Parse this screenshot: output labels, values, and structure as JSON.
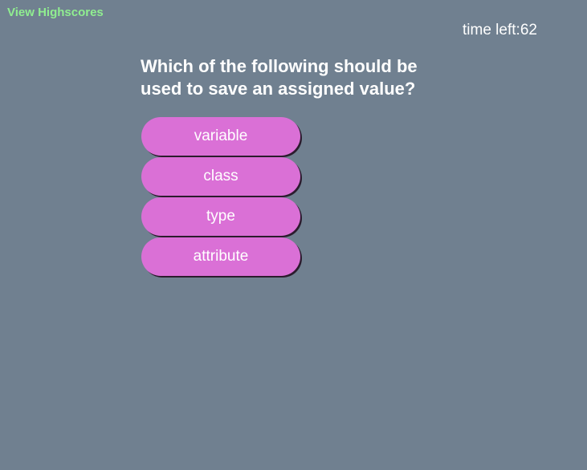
{
  "header": {
    "highscores_link": "View Highscores",
    "timer_label": "time left:",
    "timer_value": "62"
  },
  "quiz": {
    "question": "Which of the following should be used to save an assigned value?",
    "choices": [
      {
        "label": "variable"
      },
      {
        "label": "class"
      },
      {
        "label": "type"
      },
      {
        "label": "attribute"
      }
    ]
  },
  "colors": {
    "background": "#708090",
    "link": "#90ee90",
    "choice_button": "#da70d6",
    "text": "#ffffff"
  }
}
